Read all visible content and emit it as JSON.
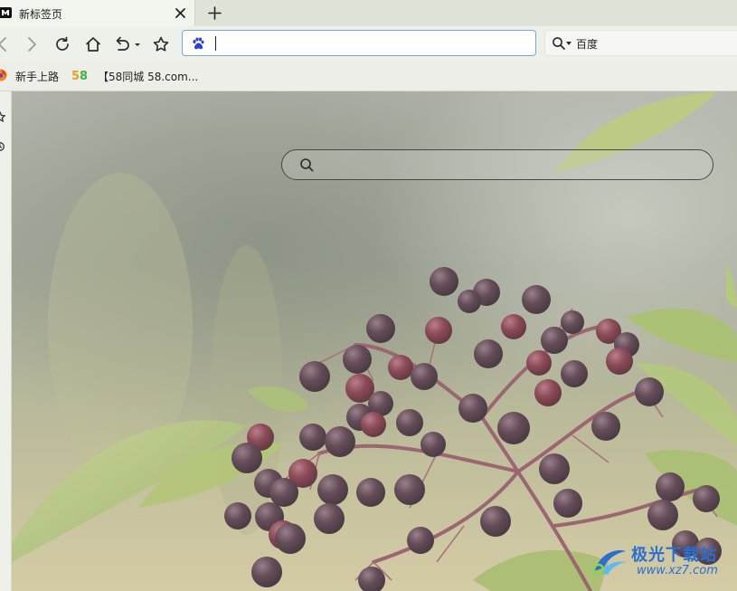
{
  "tab": {
    "title": "新标签页"
  },
  "toolbar": {
    "address_value": "",
    "search_engine_label": "百度"
  },
  "bookmarks": [
    {
      "label": "新手上路"
    },
    {
      "label": "【58同城 58.com..."
    }
  ],
  "new_tab_page": {
    "search_value": ""
  },
  "watermark": {
    "text": "极光下载站",
    "sub": "www.xz7.com"
  },
  "colors": {
    "tab_bg": "#f2f4ee",
    "toolbar_bg": "#eef0ea",
    "address_border": "#7aa6d6",
    "watermark_blue": "#2a6fd0"
  },
  "icons": [
    "maxthon-icon",
    "close-icon",
    "plus-icon",
    "back-icon",
    "forward-icon",
    "refresh-icon",
    "home-icon",
    "undo-icon",
    "star-icon",
    "baidu-paw-icon",
    "search-icon",
    "firefox-icon",
    "58-icon"
  ]
}
